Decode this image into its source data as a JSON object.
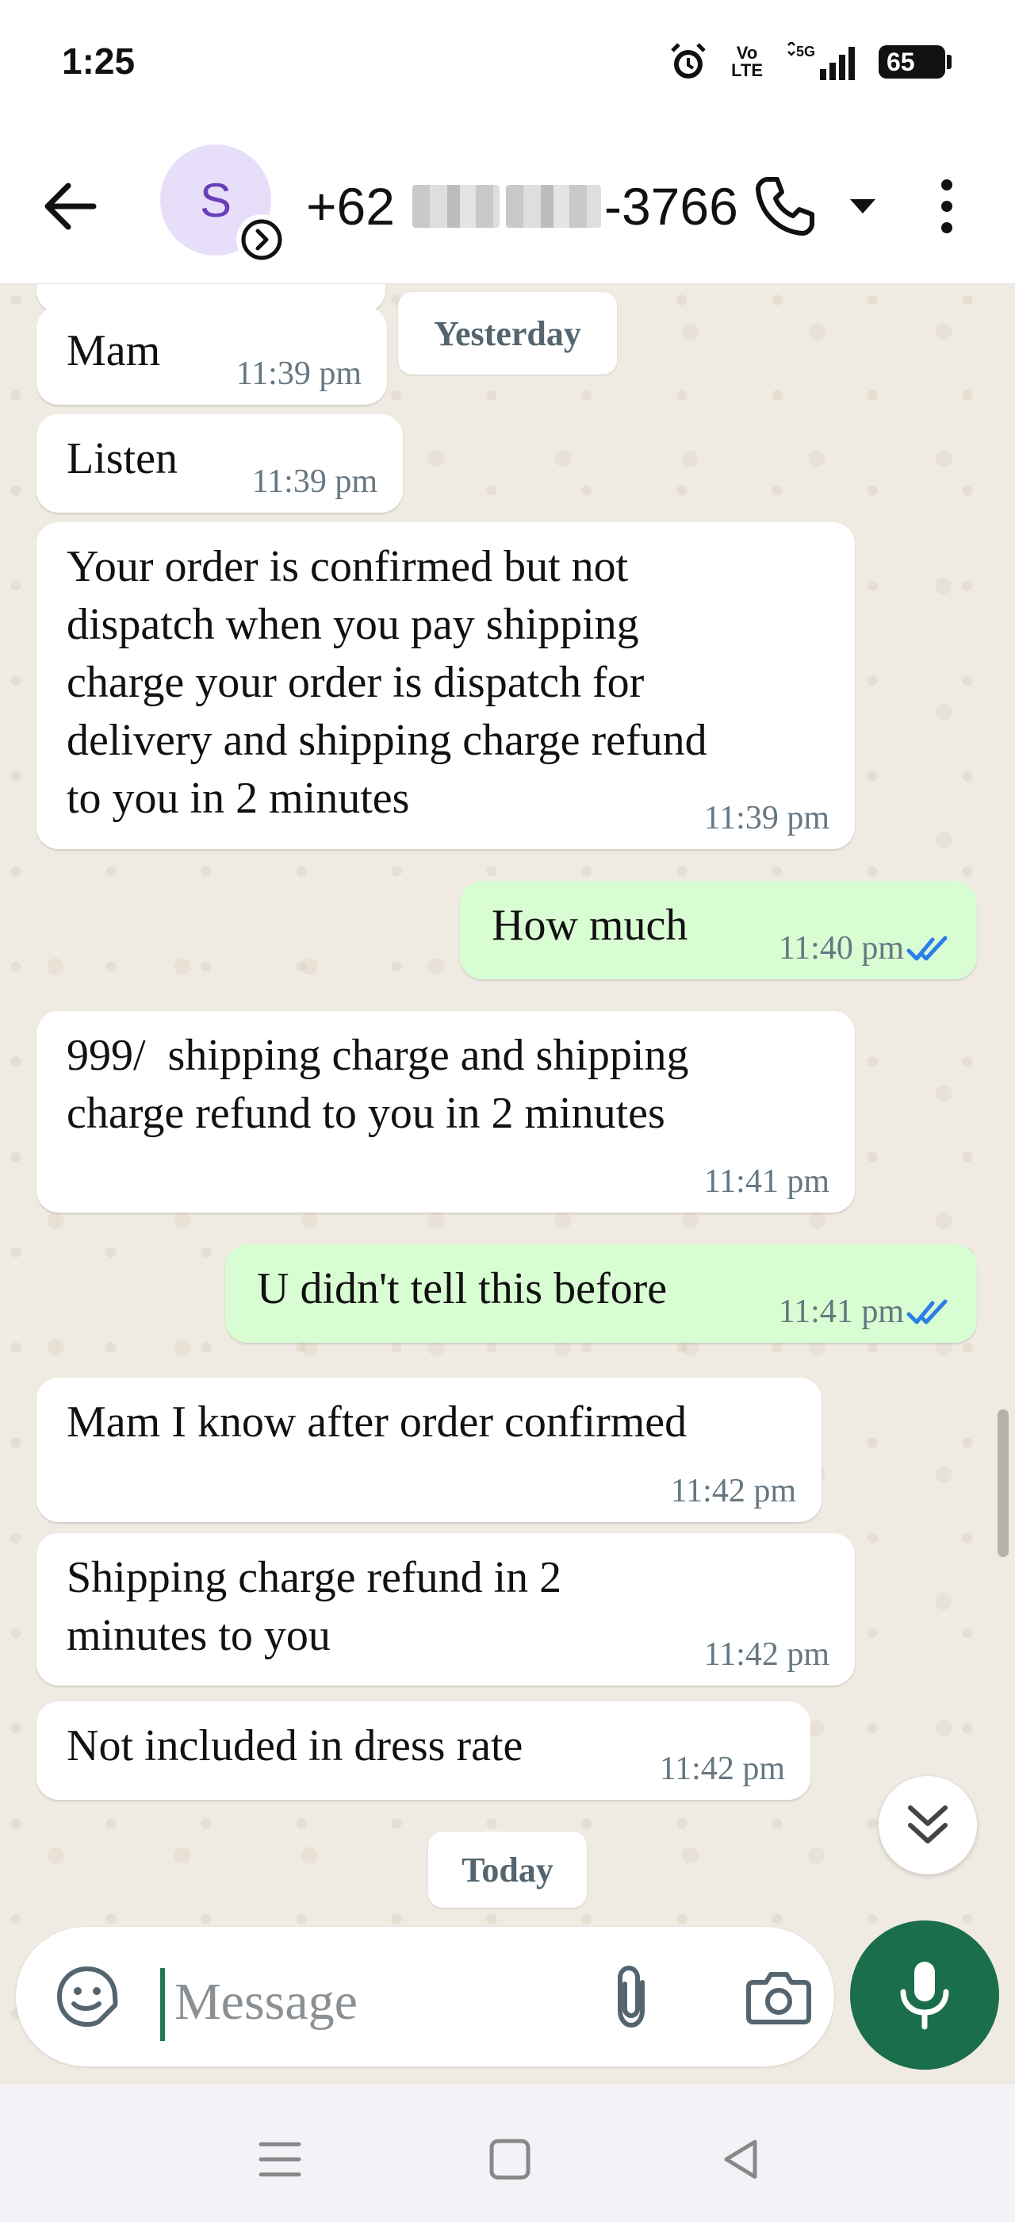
{
  "status_bar": {
    "time": "1:25",
    "volte_line1": "Vo",
    "volte_line2": "LTE",
    "network": "5G",
    "battery": "65"
  },
  "header": {
    "avatar_letter": "S",
    "contact_prefix": "+62",
    "contact_suffix": "-3766"
  },
  "chat": {
    "date_yesterday": "Yesterday",
    "date_today": "Today",
    "messages": [
      {
        "direction": "in",
        "text": "Mam",
        "time": "11:39 pm"
      },
      {
        "direction": "in",
        "text": "Listen",
        "time": "11:39 pm"
      },
      {
        "direction": "in",
        "text": "Your order is confirmed but not\ndispatch when you pay shipping\ncharge your order is dispatch for\ndelivery and shipping charge refund\nto you in 2 minutes",
        "time": "11:39 pm"
      },
      {
        "direction": "out",
        "text": "How much",
        "time": "11:40 pm",
        "status": "read"
      },
      {
        "direction": "in",
        "text": "999/  shipping charge and shipping\ncharge refund to you in 2 minutes",
        "time": "11:41 pm"
      },
      {
        "direction": "out",
        "text": "U didn't tell this before",
        "time": "11:41 pm",
        "status": "read"
      },
      {
        "direction": "in",
        "text": "Mam I know after order confirmed",
        "time": "11:42 pm"
      },
      {
        "direction": "in",
        "text": "Shipping charge refund in 2\nminutes to you",
        "time": "11:42 pm"
      },
      {
        "direction": "in",
        "text": "Not included in dress rate",
        "time": "11:42 pm"
      }
    ]
  },
  "composer": {
    "placeholder": "Message"
  },
  "icons": {
    "back": "arrow-left-icon",
    "call": "phone-icon",
    "dropdown": "caret-down-icon",
    "menu": "more-vert-icon",
    "emoji": "sticker-icon",
    "attach": "paperclip-icon",
    "camera": "camera-icon",
    "mic": "mic-icon",
    "scroll_down": "double-chevron-down-icon"
  },
  "colors": {
    "incoming_bubble": "#ffffff",
    "outgoing_bubble": "#d9fdd3",
    "read_ticks": "#2b7de9",
    "mic_button": "#1b6e4b",
    "chat_background": "#efeae2"
  }
}
